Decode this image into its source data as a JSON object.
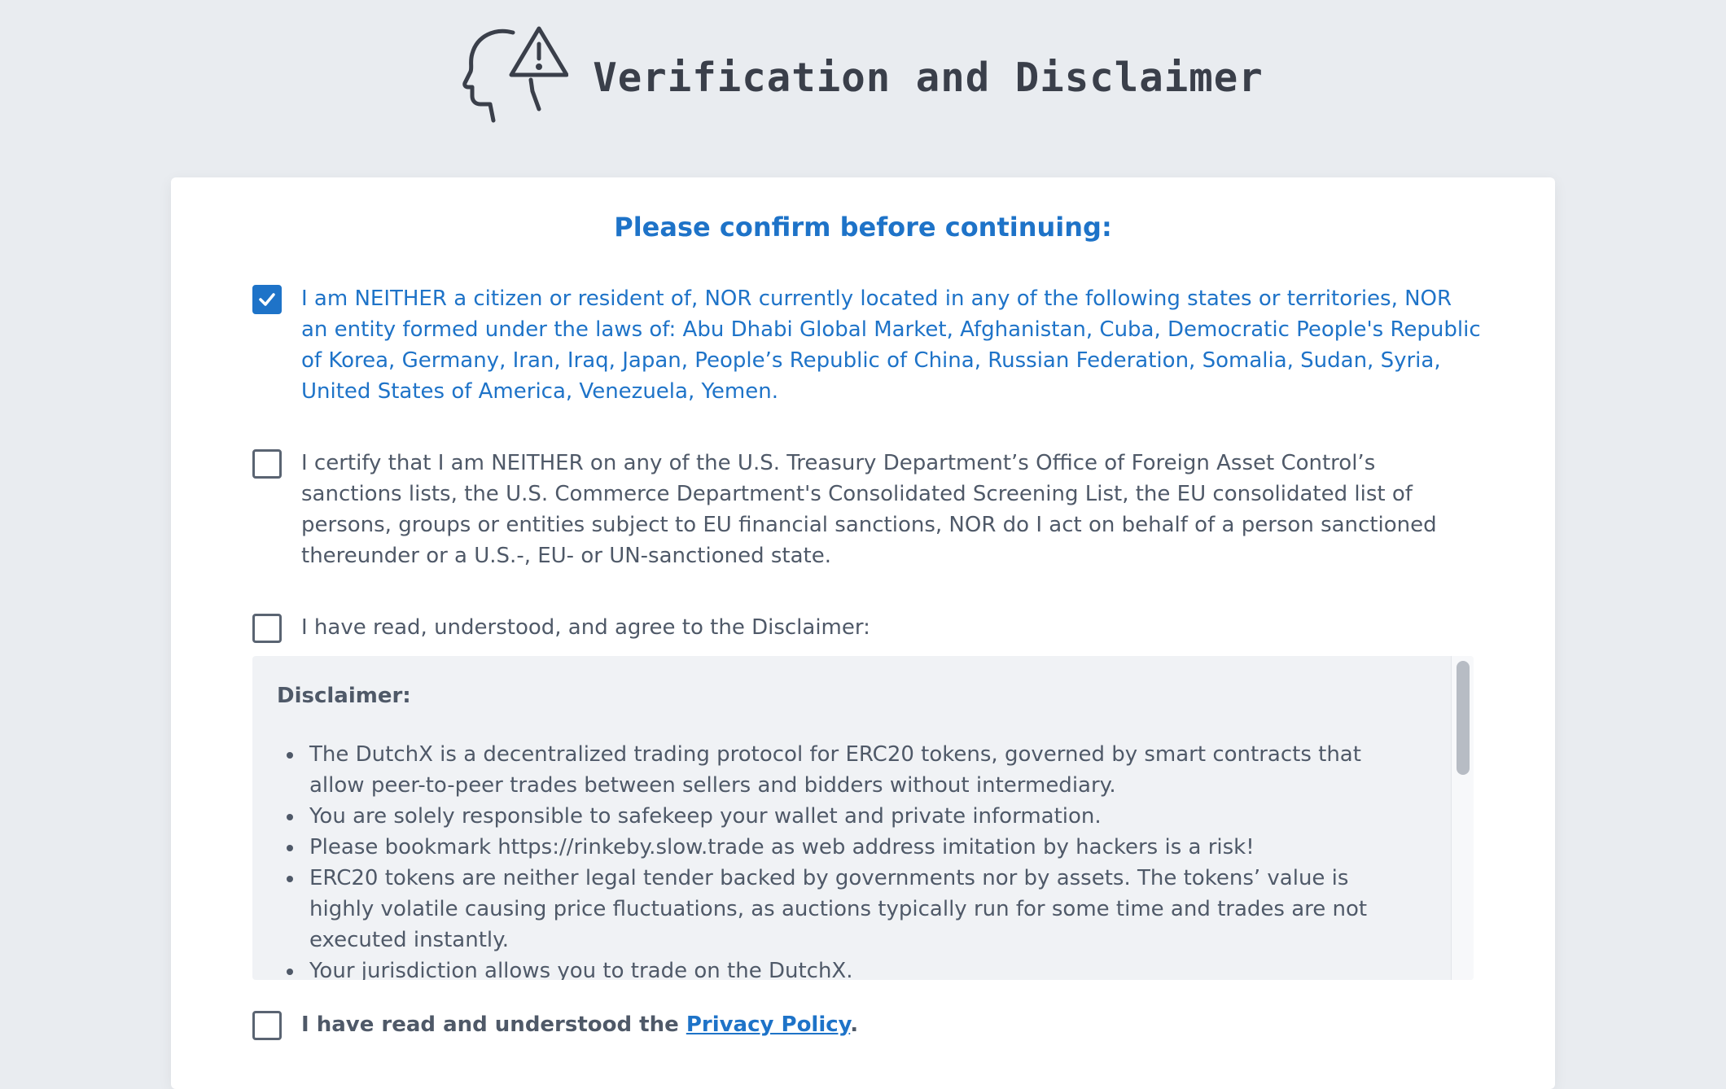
{
  "header": {
    "title": "Verification and Disclaimer",
    "icon": "head-warning-icon"
  },
  "card": {
    "heading": "Please confirm before continuing:",
    "items": [
      {
        "checked": true,
        "text": "I am NEITHER a citizen or resident of, NOR currently located in any of the following states or territories, NOR an entity formed under the laws of: Abu Dhabi Global Market, Afghanistan, Cuba, Democratic People's Republic of Korea, Germany, Iran, Iraq, Japan, People’s Republic of China, Russian Federation, Somalia, Sudan, Syria, United States of America, Venezuela, Yemen."
      },
      {
        "checked": false,
        "text": "I certify that I am NEITHER on any of the U.S. Treasury Department’s Office of Foreign Asset Control’s sanctions lists, the U.S. Commerce Department's Consolidated Screening List, the EU consolidated list of persons, groups or entities subject to EU financial sanctions, NOR do I act on behalf of a person sanctioned thereunder or a U.S.-, EU- or UN-sanctioned state."
      },
      {
        "checked": false,
        "text": "I have read, understood, and agree to the Disclaimer:"
      }
    ],
    "disclaimer": {
      "title": "Disclaimer:",
      "bullets": [
        "The DutchX is a decentralized trading protocol for ERC20 tokens, governed by smart contracts that allow peer-to-peer trades between sellers and bidders without intermediary.",
        "You are solely responsible to safekeep your wallet and private information.",
        "Please bookmark https://rinkeby.slow.trade as web address imitation by hackers is a risk!",
        "ERC20 tokens are neither legal tender backed by governments nor by assets. The tokens’ value is highly volatile causing price fluctuations, as auctions typically run for some time and trades are not executed instantly.",
        "Your jurisdiction allows you to trade on the DutchX."
      ]
    },
    "privacy": {
      "checked": false,
      "prefix": "I have read and understood the ",
      "link_text": "Privacy Policy",
      "suffix": "."
    }
  },
  "colors": {
    "accent": "#1e73c8",
    "background": "#e9ecf0",
    "text": "#4f5968"
  }
}
